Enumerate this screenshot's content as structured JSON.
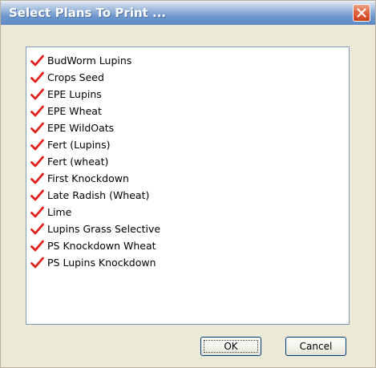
{
  "window": {
    "title": "Select Plans To Print ..."
  },
  "plans": [
    {
      "label": "BudWorm Lupins",
      "checked": true
    },
    {
      "label": "Crops Seed",
      "checked": true
    },
    {
      "label": "EPE Lupins",
      "checked": true
    },
    {
      "label": "EPE Wheat",
      "checked": true
    },
    {
      "label": "EPE WildOats",
      "checked": true
    },
    {
      "label": "Fert (Lupins)",
      "checked": true
    },
    {
      "label": "Fert (wheat)",
      "checked": true
    },
    {
      "label": "First Knockdown",
      "checked": true
    },
    {
      "label": "Late Radish (Wheat)",
      "checked": true
    },
    {
      "label": "Lime",
      "checked": true
    },
    {
      "label": "Lupins Grass Selective",
      "checked": true
    },
    {
      "label": "PS Knockdown Wheat",
      "checked": true
    },
    {
      "label": "PS Lupins Knockdown",
      "checked": true
    }
  ],
  "buttons": {
    "ok_label": "OK",
    "cancel_label": "Cancel"
  },
  "icons": {
    "close": "close-icon",
    "check": "checkmark-icon"
  },
  "colors": {
    "check": "#e0201c",
    "close_button": "#d9522a",
    "title_bar": "#6f96cd"
  }
}
